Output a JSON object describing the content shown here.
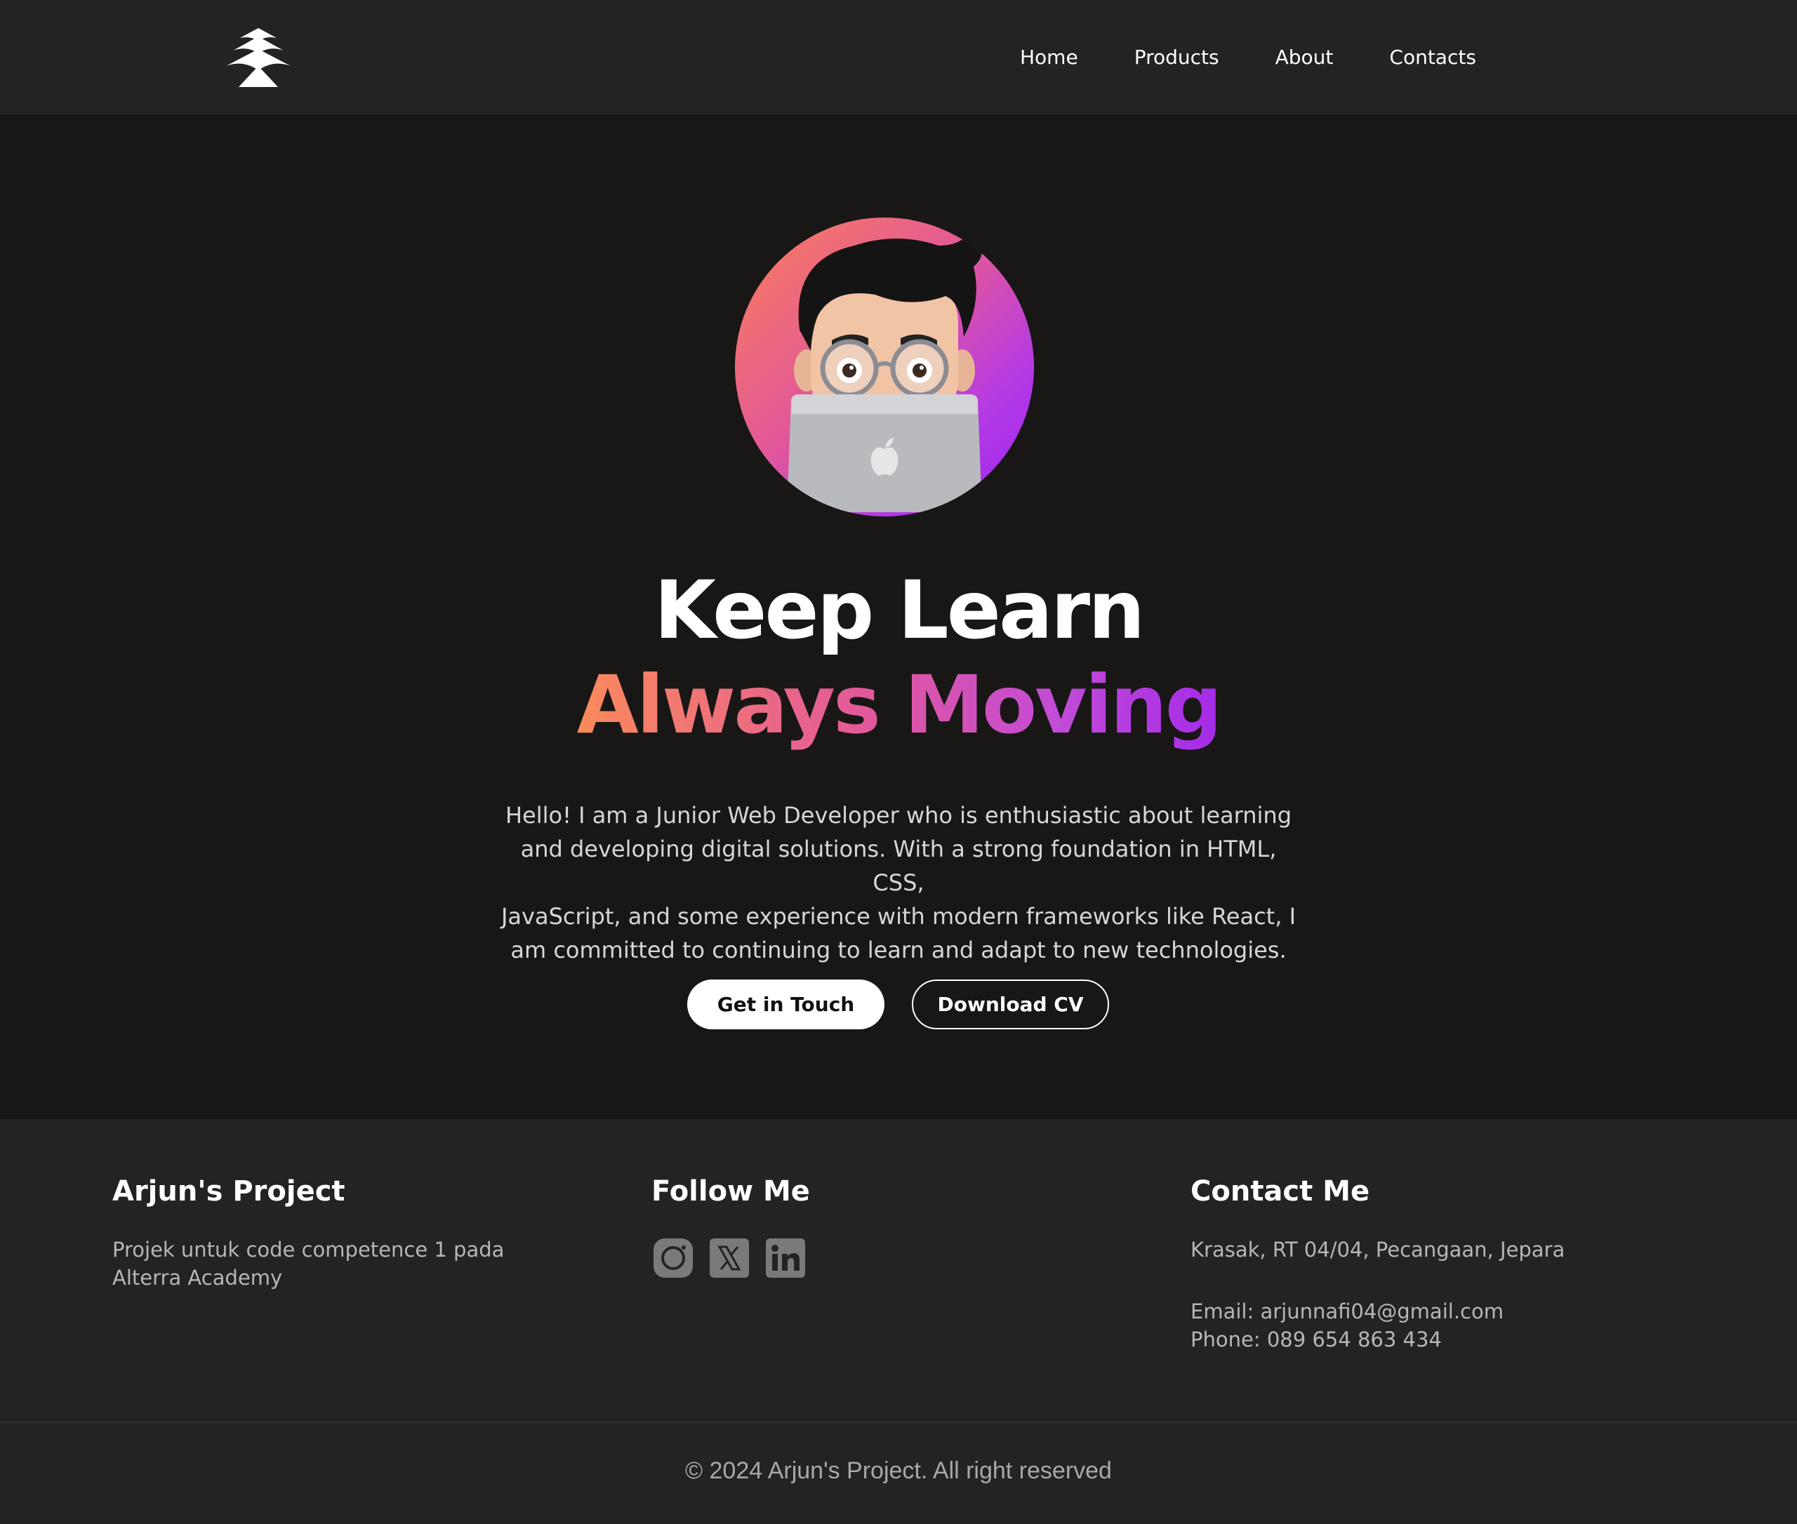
{
  "nav": {
    "logo_icon": "pine-tree-logo-icon",
    "links": [
      "Home",
      "Products",
      "About",
      "Contacts"
    ]
  },
  "hero": {
    "avatar_icon": "memoji-developer-avatar",
    "title_line1": "Keep Learn",
    "title_line2": "Always Moving",
    "description_lines": [
      "Hello! I am a Junior Web Developer who is enthusiastic about learning",
      "and developing digital solutions. With a strong foundation in HTML, CSS,",
      "JavaScript, and some experience with modern frameworks like React, I",
      "am committed to continuing to learn and adapt to new technologies."
    ],
    "primary_button": "Get in Touch",
    "secondary_button": "Download CV",
    "gradient_colors": [
      "#fb8a5b",
      "#e2589b",
      "#a42be8"
    ]
  },
  "footer": {
    "about": {
      "heading": "Arjun's Project",
      "lines": [
        "Projek untuk code competence 1 pada",
        "Alterra Academy"
      ]
    },
    "follow": {
      "heading": "Follow Me",
      "icons": [
        "instagram-icon",
        "x-twitter-icon",
        "linkedin-icon"
      ]
    },
    "contact": {
      "heading": "Contact Me",
      "address": "Krasak, RT 04/04, Pecangaan, Jepara",
      "email": "Email: arjunnafi04@gmail.com",
      "phone": "Phone: 089 654 863 434"
    },
    "copyright": "© 2024 Arjun's Project. All right reserved"
  },
  "colors": {
    "background": "#181716",
    "navbar": "#232323",
    "footer": "#232323"
  }
}
